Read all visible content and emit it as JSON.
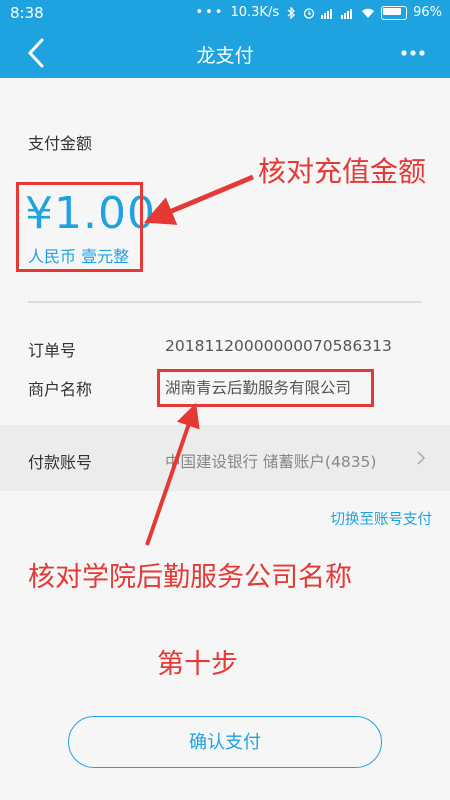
{
  "status_bar": {
    "time": "8:38",
    "network_speed": "10.3K/s",
    "battery": "96%"
  },
  "header": {
    "title": "龙支付"
  },
  "payment": {
    "amount_label": "支付金额",
    "amount": "¥1.00",
    "amount_in_words": "人民币 壹元整",
    "order_no_label": "订单号",
    "order_no": "20181120000000070586313",
    "merchant_label": "商户名称",
    "merchant_name": "湖南青云后勤服务有限公司",
    "account_label": "付款账号",
    "account_value": "中国建设银行  储蓄账户(4835)",
    "switch_link": "切换至账号支付",
    "confirm_button": "确认支付"
  },
  "annotations": {
    "amount_note": "核对充值金额",
    "merchant_note": "核对学院后勤服务公司名称",
    "step": "第十步"
  },
  "colors": {
    "accent": "#1fa3e0",
    "annotation": "#e53935"
  }
}
